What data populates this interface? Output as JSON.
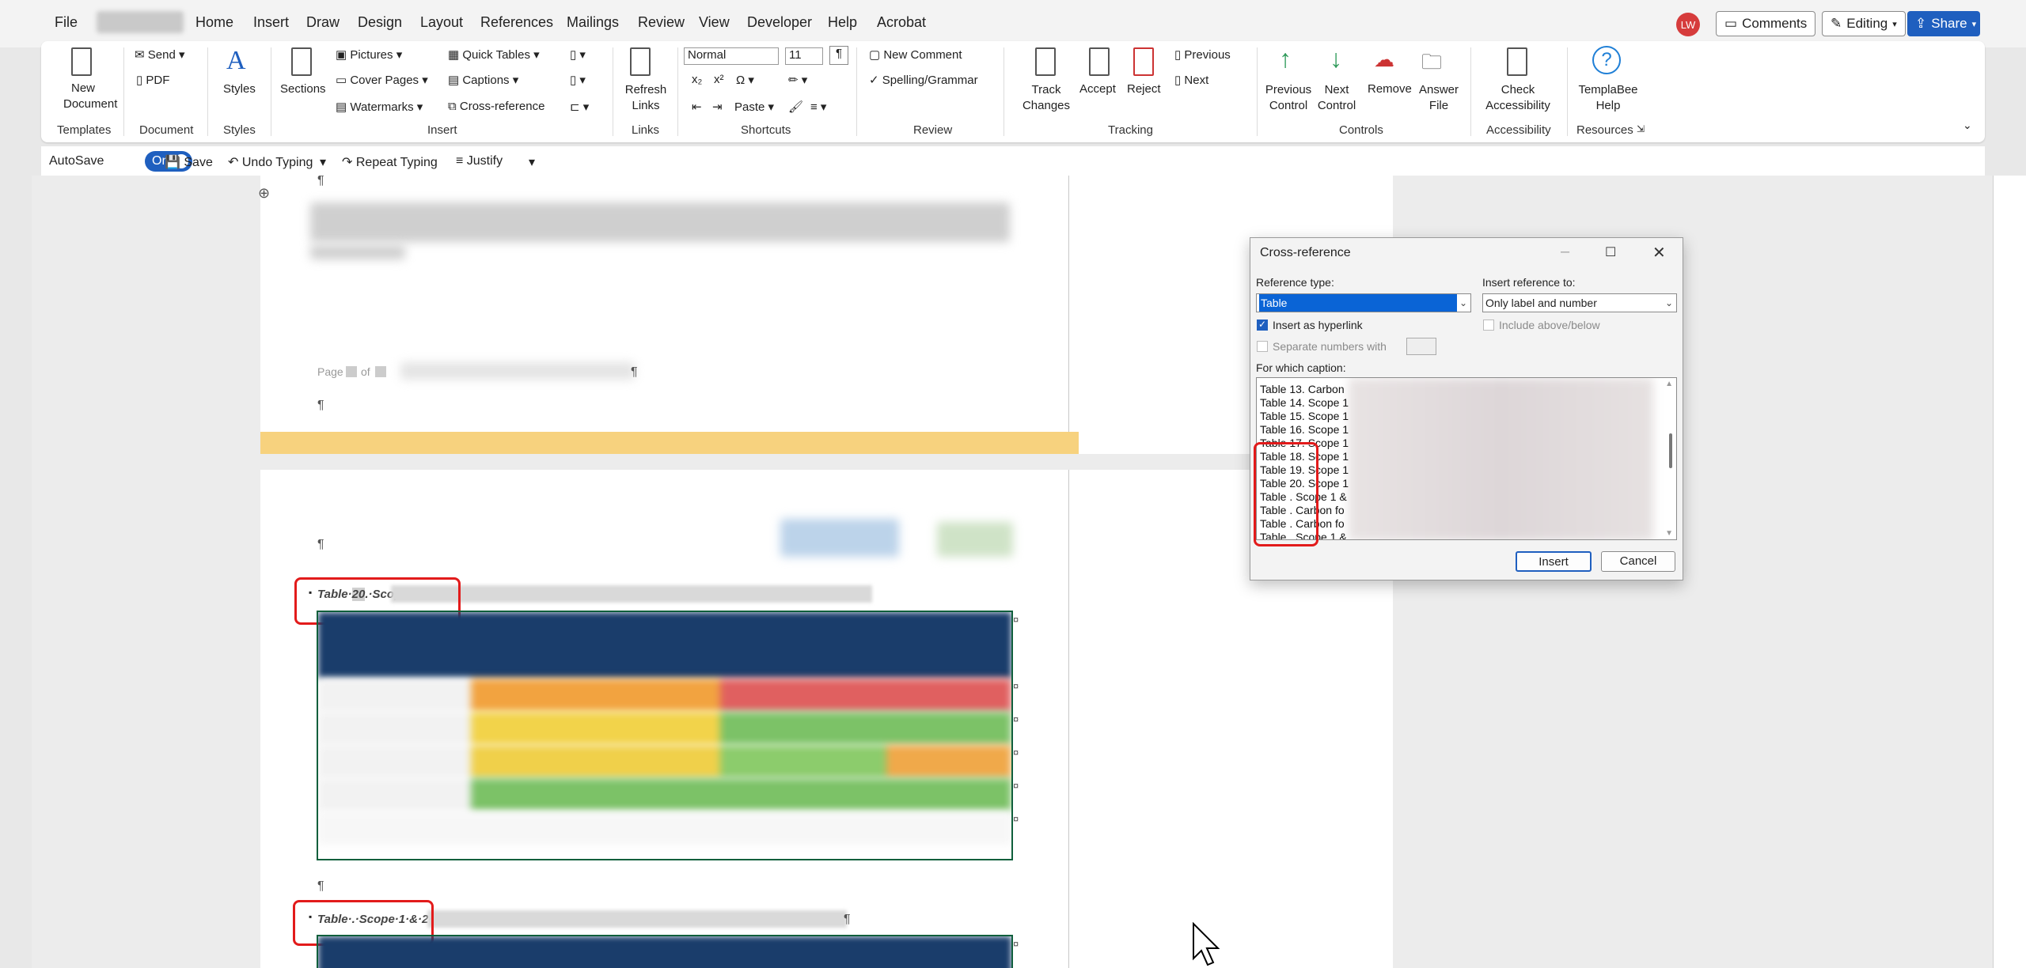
{
  "menubar": {
    "items": [
      "File",
      "Home",
      "Insert",
      "Draw",
      "Design",
      "Layout",
      "References",
      "Mailings",
      "Review",
      "View",
      "Developer",
      "Help",
      "Acrobat"
    ],
    "avatar": "LW",
    "comments": "Comments",
    "editing": "Editing",
    "share": "Share"
  },
  "ribbon": {
    "new_document": "New Document",
    "send": "Send",
    "pdf": "PDF",
    "styles": "Styles",
    "sections": "Sections",
    "pictures": "Pictures",
    "cover_pages": "Cover Pages",
    "watermarks": "Watermarks",
    "quick_tables": "Quick Tables",
    "captions": "Captions",
    "cross_reference": "Cross-reference",
    "refresh_links": "Refresh Links",
    "style_value": "Normal",
    "size_value": "11",
    "paste": "Paste",
    "new_comment": "New Comment",
    "spelling": "Spelling/Grammar",
    "track_changes": "Track Changes",
    "accept": "Accept",
    "reject": "Reject",
    "previous": "Previous",
    "next": "Next",
    "previous_control": "Previous Control",
    "next_control": "Next Control",
    "remove": "Remove",
    "answer_file": "Answer File",
    "check_accessibility": "Check Accessibility",
    "templabee_help": "TemplaBee Help",
    "groups": {
      "templates": "Templates",
      "document": "Document",
      "styles": "Styles",
      "insert": "Insert",
      "links": "Links",
      "shortcuts": "Shortcuts",
      "review": "Review",
      "tracking": "Tracking",
      "controls": "Controls",
      "accessibility": "Accessibility",
      "resources": "Resources"
    }
  },
  "qat": {
    "autosave": "AutoSave",
    "toggle": "On",
    "save": "Save",
    "undo": "Undo Typing",
    "repeat": "Repeat Typing",
    "justify": "Justify"
  },
  "document": {
    "pilcrow": "¶",
    "footer_text": "Page",
    "footer_of": "of",
    "caption1_prefix": "Table·",
    "caption1_number": "20",
    "caption1_suffix": ".·Scope",
    "caption2": "Table·.·Scope·1·&·2·"
  },
  "dialog": {
    "title": "Cross-reference",
    "reference_type_label": "Reference type:",
    "reference_type_value": "Table",
    "insert_reference_label": "Insert reference to:",
    "insert_reference_value": "Only label and number",
    "insert_hyperlink": "Insert as hyperlink",
    "include_above_below": "Include above/below",
    "separate_numbers": "Separate numbers with",
    "for_which_caption": "For which caption:",
    "captions": [
      "Table 13. Carbon",
      "Table 14. Scope 1",
      "Table 15. Scope 1",
      "Table 16. Scope 1",
      "Table 17. Scope 1",
      "Table 18. Scope 1",
      "Table 19. Scope 1",
      "Table 20. Scope 1",
      "Table . Scope 1 &",
      "Table . Carbon fo",
      "Table . Carbon fo",
      "Table . Scope 1 &"
    ],
    "insert_button": "Insert",
    "cancel_button": "Cancel"
  }
}
